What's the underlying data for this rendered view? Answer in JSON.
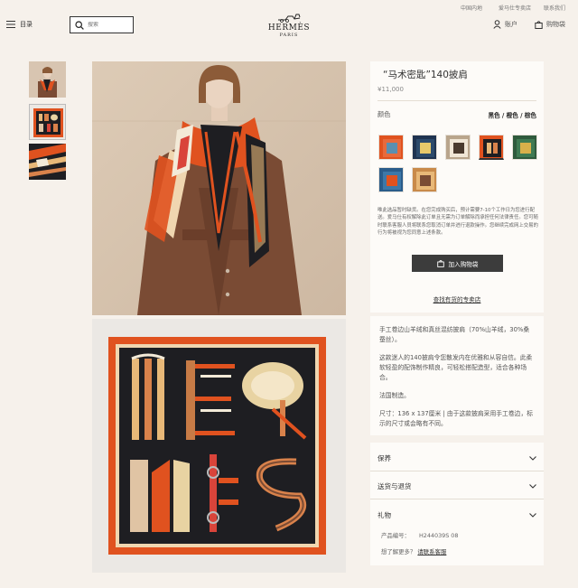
{
  "topbar": {
    "links": [
      "中国内地",
      "爱马仕专卖店",
      "联系我们"
    ]
  },
  "header": {
    "menu_label": "目录",
    "search_placeholder": "搜索",
    "logo_brand": "HERMÈS",
    "logo_city": "PARIS",
    "account_label": "账户",
    "cart_label": "购物袋"
  },
  "product": {
    "title": "“马术密匙”140披肩",
    "price": "¥11,000",
    "color_label": "颜色",
    "selected_color": "黑色 / 橙色 / 棕色",
    "availability_note": "唯此选品暂时缺货。在您完成购买后，预计需要7-10个工作日为您进行配送。爱马仕有权解除此订单且无需为订单解除而承担任何法律责任。您可随时联系客服人员将联系您取消订单并进行退款操作。您继续完成网上交易的行为将被视为您同意上述条款。",
    "add_button": "加入购物袋",
    "store_link": "查找有货的专卖店",
    "description": [
      "手工卷边山羊绒和真丝混纺披肩（70%山羊绒，30%桑蚕丝）。",
      "这款迷人的140披肩令您散发内在优雅和从容自信。此柔软轻盈的配饰制作精良，可轻松搭配造型，适合各种场合。",
      "法国制造。",
      "尺寸：136 x 137厘米 | 由于这款披肩采用手工卷边，标示的尺寸或会略有不同。"
    ],
    "accordions": [
      "保养",
      "送货与退货",
      "礼物"
    ],
    "ref_label": "产品编号：",
    "ref_value": "H244039S 08",
    "help_text": "想了解更多？",
    "help_link": "请联系客服"
  },
  "colors": {
    "accent": "#e0521f",
    "dark": "#1e1e22",
    "brown": "#7a4b34",
    "button": "#3c3c3c"
  },
  "icons": [
    "hamburger-icon",
    "search-icon",
    "user-icon",
    "bag-icon",
    "chevron-down-icon"
  ]
}
